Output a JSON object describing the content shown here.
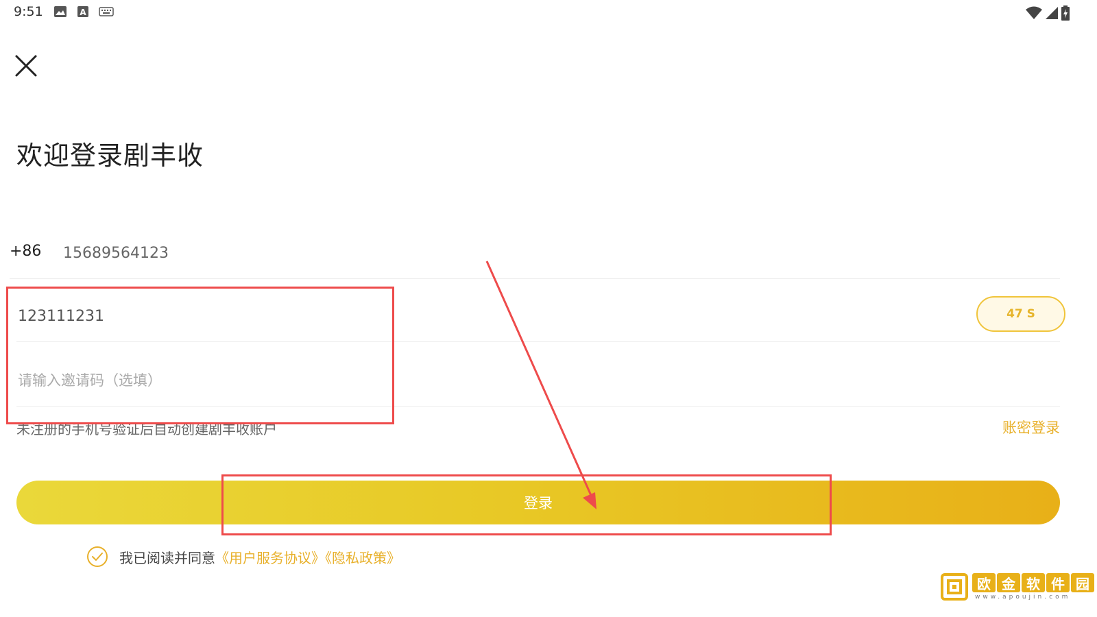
{
  "status_bar": {
    "time": "9:51",
    "left_icons": [
      "image-icon",
      "font-a-icon",
      "keyboard-icon"
    ],
    "right_icons": [
      "wifi-icon",
      "cellular-signal-icon",
      "battery-icon"
    ]
  },
  "header": {
    "close_icon": "close-icon",
    "title": "欢迎登录剧丰收"
  },
  "form": {
    "country_code": "+86",
    "phone_value": "15689564123",
    "code_value": "123111231",
    "countdown_label": "47 S",
    "invite_placeholder": "请输入邀请码（选填）",
    "hint_text": "未注册的手机号验证后自动创建剧丰收账户",
    "password_login_label": "账密登录",
    "login_button_label": "登录"
  },
  "agreement": {
    "checkbox_icon": "check-circle-icon",
    "prefix": "我已阅读并同意",
    "terms_link": "《用户服务协议》",
    "privacy_link": "《隐私政策》"
  },
  "colors": {
    "accent": "#e8b02a",
    "button_start": "#ead83a",
    "button_end": "#e8b018",
    "annotation": "#ee4b4b"
  },
  "watermark": {
    "chars": [
      "欧",
      "金",
      "软",
      "件",
      "园"
    ],
    "url": "www.apoujin.com"
  }
}
